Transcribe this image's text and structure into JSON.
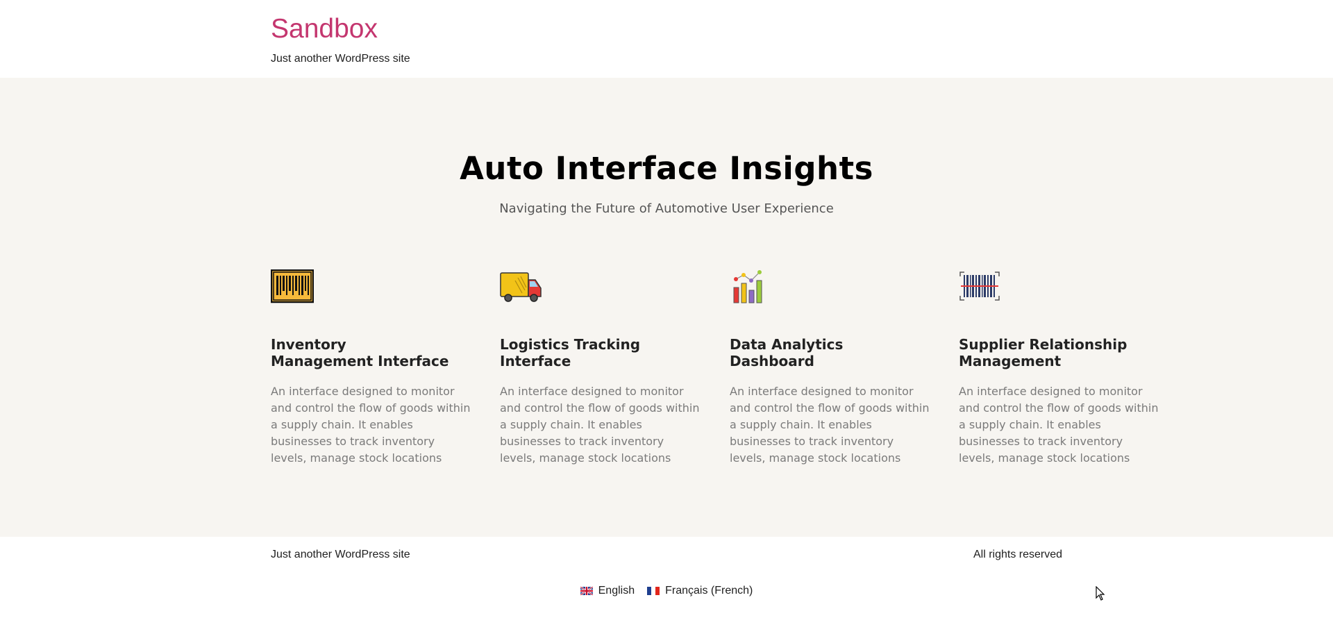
{
  "header": {
    "site_title": "Sandbox",
    "tagline": "Just another WordPress site"
  },
  "hero": {
    "title": "Auto Interface Insights",
    "subtitle": "Navigating the Future of Automotive User Experience"
  },
  "cards": [
    {
      "icon": "barcode-box-icon",
      "title": "Inventory Management Interface",
      "description": "An interface designed to monitor and control the flow of goods within a supply chain. It enables businesses to track inventory levels, manage stock locations"
    },
    {
      "icon": "delivery-truck-icon",
      "title": "Logistics Tracking Interface",
      "description": "An interface designed to monitor and control the flow of goods within a supply chain. It enables businesses to track inventory levels, manage stock locations"
    },
    {
      "icon": "bar-chart-icon",
      "title": "Data Analytics Dashboard",
      "description": "An interface designed to monitor and control the flow of goods within a supply chain. It enables businesses to track inventory levels, manage stock locations"
    },
    {
      "icon": "barcode-scan-icon",
      "title": "Supplier Relationship Management",
      "description": "An interface designed to monitor and control the flow of goods within a supply chain. It enables businesses to track inventory levels, manage stock locations"
    }
  ],
  "footer": {
    "tagline": "Just another WordPress site",
    "rights": "All rights reserved",
    "languages": [
      {
        "label": "English",
        "flag": "uk-flag-icon"
      },
      {
        "label": "Français (French)",
        "flag": "france-flag-icon"
      }
    ]
  },
  "colors": {
    "brand": "#c4366f",
    "hero_bg": "#f7f5f1"
  }
}
